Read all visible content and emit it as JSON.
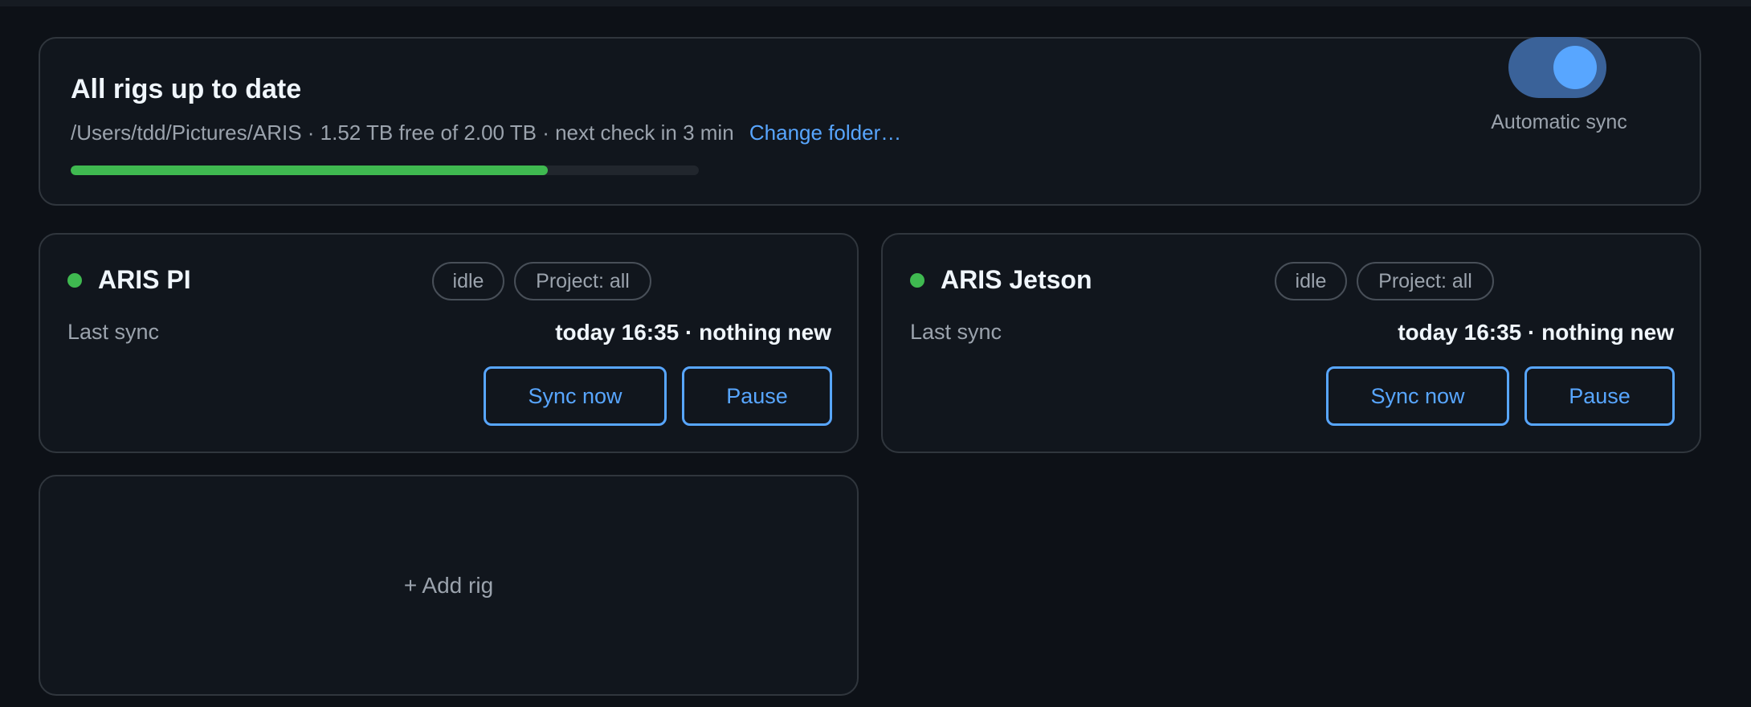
{
  "status": {
    "title": "All rigs up to date",
    "path": "/Users/tdd/Pictures/ARIS",
    "free_space": "· 1.52 TB free of 2.00 TB",
    "next_check": "· next check in 3 min",
    "change_folder_label": "Change folder…",
    "disk_used_fraction": 0.76,
    "accent_color": "#3fb950"
  },
  "auto_sync": {
    "label": "Automatic sync",
    "enabled": true,
    "color": "#58a6ff"
  },
  "rigs": [
    {
      "name": "ARIS PI",
      "status_dot_color": "#3fb950",
      "state_chip": "idle",
      "project_chip": "Project: all",
      "last_sync_label": "Last sync",
      "last_sync_value": "today 16:35 · nothing new",
      "sync_label": "Sync now",
      "pause_label": "Pause"
    },
    {
      "name": "ARIS Jetson",
      "status_dot_color": "#3fb950",
      "state_chip": "idle",
      "project_chip": "Project: all",
      "last_sync_label": "Last sync",
      "last_sync_value": "today 16:35 · nothing new",
      "sync_label": "Sync now",
      "pause_label": "Pause"
    }
  ],
  "add_rig": {
    "label": "+ Add rig"
  }
}
